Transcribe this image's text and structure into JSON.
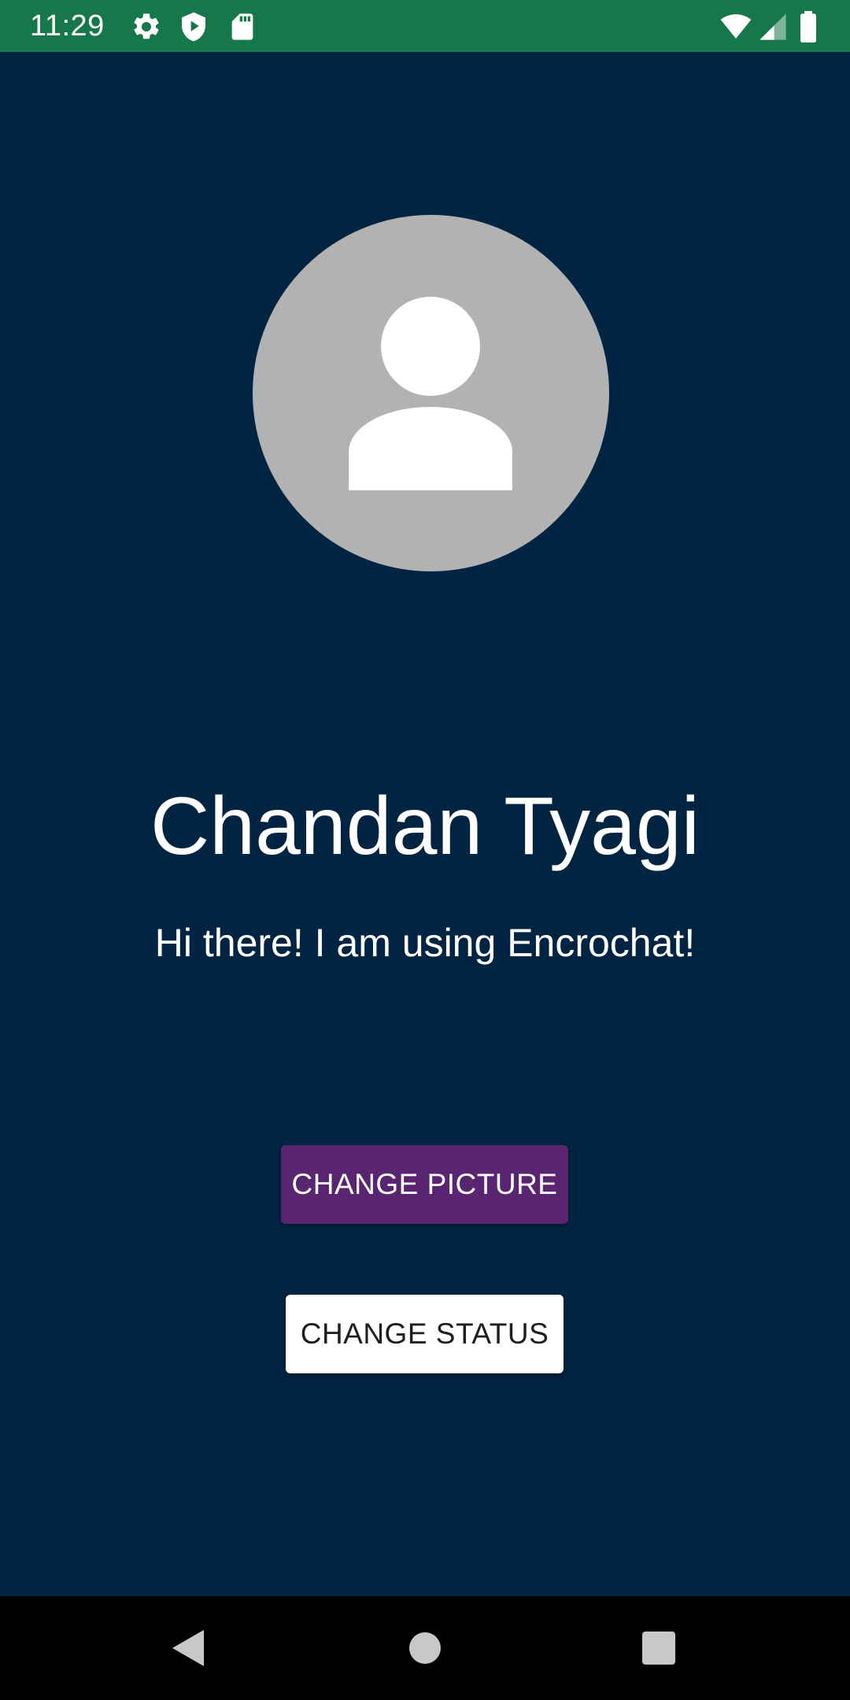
{
  "status_bar": {
    "time": "11:29",
    "icons_left": [
      "gear-icon",
      "shield-play-icon",
      "sd-card-icon"
    ],
    "icons_right": [
      "wifi-icon",
      "signal-icon",
      "battery-icon"
    ],
    "color": "#15774a"
  },
  "profile": {
    "avatar_icon": "person-placeholder-icon",
    "name": "Chandan Tyagi",
    "status": "Hi there! I am using Encrochat!"
  },
  "actions": {
    "change_picture_label": "Change Picture",
    "change_status_label": "Change Status"
  },
  "navigation": {
    "back": "back-icon",
    "home": "home-icon",
    "recents": "recents-icon"
  },
  "colors": {
    "background": "#012442",
    "accent": "#5a2570",
    "avatar_bg": "#b2b2b2"
  }
}
